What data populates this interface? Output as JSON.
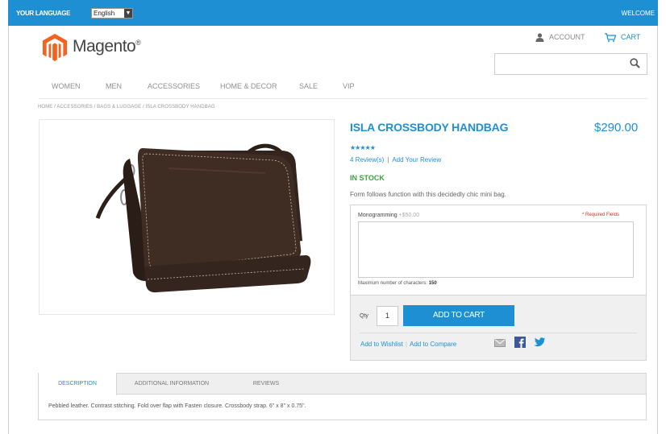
{
  "topbar": {
    "language_label": "YOUR LANGUAGE",
    "language_value": "English",
    "welcome": "WELCOME"
  },
  "header": {
    "logo_text": "Magento",
    "logo_mark": "®",
    "account_label": "ACCOUNT",
    "cart_label": "CART",
    "search_value": ""
  },
  "nav": {
    "items": [
      "WOMEN",
      "MEN",
      "ACCESSORIES",
      "HOME & DECOR",
      "SALE",
      "VIP"
    ]
  },
  "breadcrumb": "HOME  /  ACCESSORIES  /  BAGS & LUGGAGE  /  ISLA CROSSBODY HANDBAG",
  "product": {
    "name": "ISLA CROSSBODY HANDBAG",
    "price": "$290.00",
    "rating": 5,
    "stars": "★★★★★",
    "reviews_link": "4 Review(s)",
    "reviews_sep": "|",
    "add_review_link": "Add Your Review",
    "stock": "IN STOCK",
    "short_description": "Form follows function with this decidedly chic mini bag."
  },
  "options": {
    "monogram_label": "Monogramming",
    "monogram_extra": "+$50.00",
    "required_note": "* Required Fields",
    "textarea_value": "",
    "max_chars_label": "Maximum number of characters:",
    "max_chars_value": "150"
  },
  "cart": {
    "qty_label": "Qty",
    "qty_value": "1",
    "add_button": "ADD TO CART",
    "wishlist_link": "Add to Wishlist",
    "compare_link": "Add to Compare",
    "link_sep": "|"
  },
  "tabs": {
    "items": [
      "DESCRIPTION",
      "ADDITIONAL INFORMATION",
      "REVIEWS"
    ],
    "active": "DESCRIPTION",
    "content": "Pebbled leather. Contrast stitching. Fold over flap with Fasten closure. Crossbody strap. 6\" x 8\" x 0.75\"."
  },
  "colors": {
    "accent": "#1f8fd3",
    "logo_orange": "#f26322",
    "stock_green": "#3aa53a",
    "required_red": "#e02b27",
    "bag_brown": "#3b2a22"
  },
  "icons": [
    "user-icon",
    "cart-icon",
    "search-icon",
    "mail-icon",
    "facebook-icon",
    "twitter-icon",
    "select-arrow-icon"
  ]
}
